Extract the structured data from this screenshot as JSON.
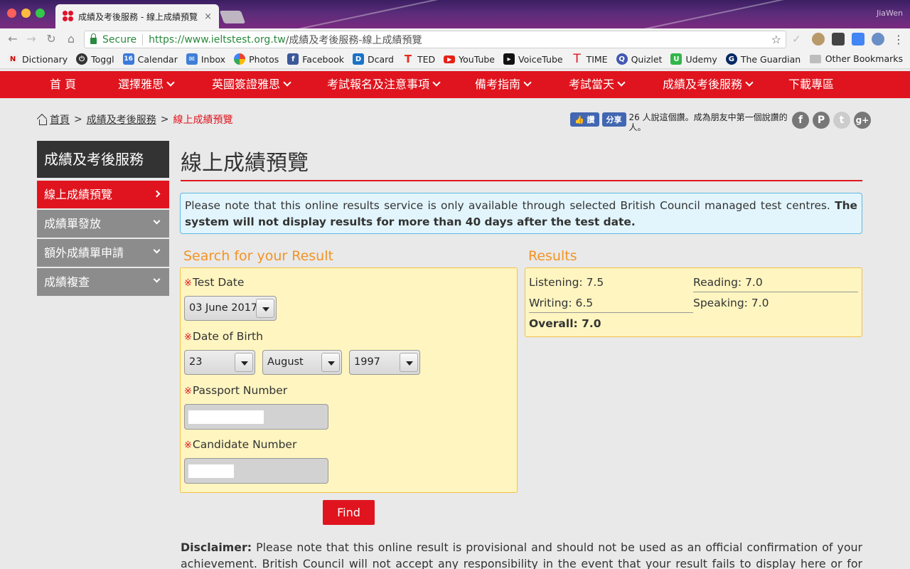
{
  "browser": {
    "tab_title": "成績及考後服務 - 線上成績預覽",
    "tab_close": "×",
    "user_name": "JiaWen",
    "secure_label": "Secure",
    "url_host": "https://www.ieltstest.org.tw",
    "url_path": "/成績及考後服務-線上成績預覽",
    "bookmarks": [
      {
        "label": "Dictionary",
        "icon": "dictionary-icon",
        "color": "#ffffff"
      },
      {
        "label": "Toggl",
        "icon": "toggl-icon",
        "color": "#333333"
      },
      {
        "label": "Calendar",
        "icon": "calendar-icon",
        "color": "#3b7ad9"
      },
      {
        "label": "Inbox",
        "icon": "inbox-icon",
        "color": "#3f7fd6"
      },
      {
        "label": "Photos",
        "icon": "photos-icon",
        "color": "#f4b400"
      },
      {
        "label": "Facebook",
        "icon": "facebook-icon",
        "color": "#3b5998"
      },
      {
        "label": "Dcard",
        "icon": "dcard-icon",
        "color": "#1a73c5"
      },
      {
        "label": "TED",
        "icon": "ted-icon",
        "color": "#e62b1e"
      },
      {
        "label": "YouTube",
        "icon": "youtube-icon",
        "color": "#e62117"
      },
      {
        "label": "VoiceTube",
        "icon": "voicetube-icon",
        "color": "#111111"
      },
      {
        "label": "TIME",
        "icon": "time-icon",
        "color": "#e0141e"
      },
      {
        "label": "Quizlet",
        "icon": "quizlet-icon",
        "color": "#4257b2"
      },
      {
        "label": "Udemy",
        "icon": "udemy-icon",
        "color": "#32b54a"
      },
      {
        "label": "The Guardian",
        "icon": "guardian-icon",
        "color": "#052962"
      }
    ],
    "other_bookmarks": "Other Bookmarks"
  },
  "site_nav": {
    "items": [
      {
        "label": "首 頁",
        "has_menu": false
      },
      {
        "label": "選擇雅思",
        "has_menu": true
      },
      {
        "label": "英國簽證雅思",
        "has_menu": true
      },
      {
        "label": "考試報名及注意事項",
        "has_menu": true
      },
      {
        "label": "備考指南",
        "has_menu": true
      },
      {
        "label": "考試當天",
        "has_menu": true
      },
      {
        "label": "成績及考後服務",
        "has_menu": true
      },
      {
        "label": "下載專區",
        "has_menu": false
      }
    ]
  },
  "breadcrumb": {
    "home": "首頁",
    "sep": ">",
    "section": "成績及考後服務",
    "current": "線上成績預覽"
  },
  "social": {
    "like_label": "讚",
    "share_label": "分享",
    "like_text": "26 人說這個讚。成為朋友中第一個說讚的人。"
  },
  "sidebar": {
    "heading": "成績及考後服務",
    "items": [
      {
        "label": "線上成績預覽",
        "active": true
      },
      {
        "label": "成績單發放",
        "active": false
      },
      {
        "label": "額外成績單申請",
        "active": false
      },
      {
        "label": "成績複查",
        "active": false
      }
    ]
  },
  "main": {
    "title": "線上成績預覽",
    "notice_normal": "Please note that this online results service is only available through selected British Council managed test centres. ",
    "notice_bold": "The system will not display results for more than 40 days after the test date."
  },
  "search": {
    "title": "Search for your Result",
    "required_mark": "※",
    "test_date_label": "Test Date",
    "test_date_value": "03 June 2017",
    "dob_label": "Date of Birth",
    "dob_day": "23",
    "dob_month": "August",
    "dob_year": "1997",
    "passport_label": "Passport Number",
    "candidate_label": "Candidate Number",
    "find_label": "Find"
  },
  "results": {
    "title": "Results",
    "listening": "Listening: 7.5",
    "reading": "Reading: 7.0",
    "writing": "Writing: 6.5",
    "speaking": "Speaking: 7.0",
    "overall": "Overall: 7.0"
  },
  "disclaimer": {
    "label": "Disclaimer:",
    "text": " Please note that this online result is provisional and should not be used as an official confirmation of your achievement. British Council will not accept any responsibility in the event that your result fails to display here or for any"
  },
  "colors": {
    "brand_red": "#e0141e",
    "section_orange": "#f29423",
    "panel_yellow": "#fef5c0",
    "notice_blue": "#e2f5fc"
  }
}
